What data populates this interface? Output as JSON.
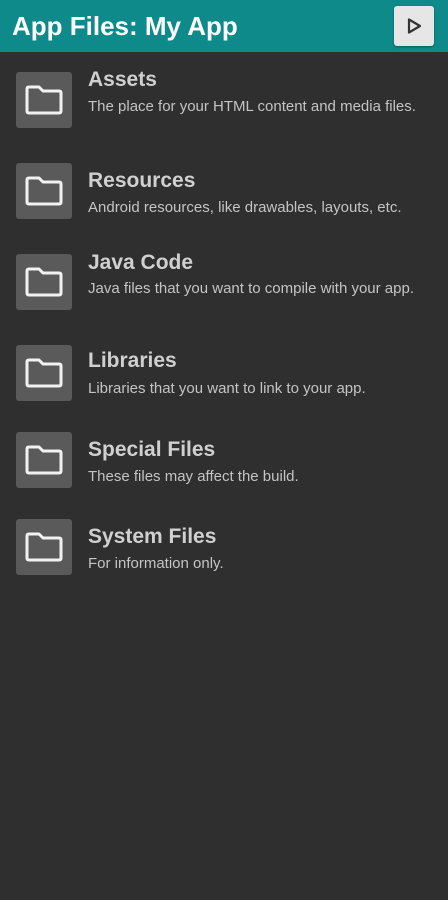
{
  "toolbar": {
    "title": "App Files: My App",
    "run_icon": "play-icon",
    "background_color": "#0e8a8a"
  },
  "files": [
    {
      "title": "Assets",
      "description": "The place for your HTML content and media files.",
      "icon": "folder-icon"
    },
    {
      "title": "Resources",
      "description": "Android resources, like drawables, layouts, etc.",
      "icon": "folder-icon"
    },
    {
      "title": "Java Code",
      "description": "Java files that you want to compile with your app.",
      "icon": "folder-icon"
    },
    {
      "title": "Libraries",
      "description": "Libraries that you want to link to your app.",
      "icon": "folder-icon"
    },
    {
      "title": "Special Files",
      "description": "These files may affect the build.",
      "icon": "folder-icon"
    },
    {
      "title": "System Files",
      "description": "For information only.",
      "icon": "folder-icon"
    }
  ]
}
